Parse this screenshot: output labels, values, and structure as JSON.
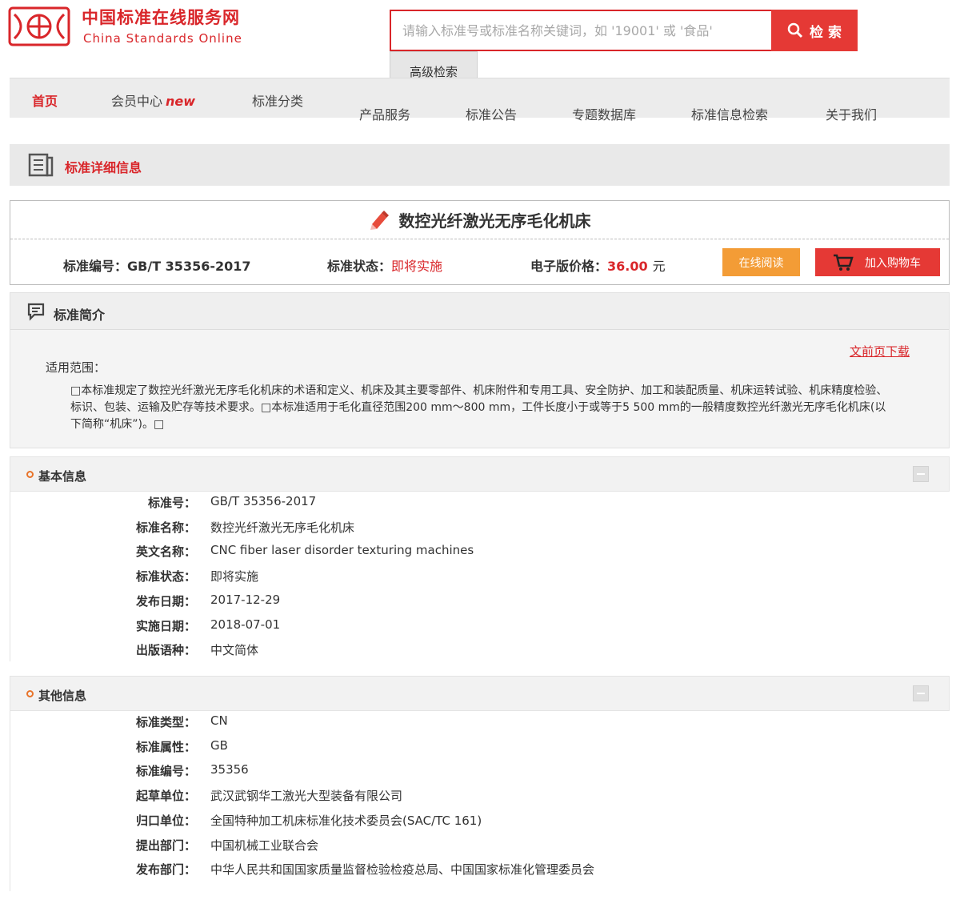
{
  "header": {
    "brand_cn": "中国标准在线服务网",
    "brand_en": "China Standards Online",
    "search_placeholder": "请输入标准号或标准名称关键词，如 '19001' 或 '食品'",
    "search_button": "检 索",
    "advanced_search": "高级检索"
  },
  "nav": {
    "items": [
      "首页",
      "会员中心",
      "标准分类",
      "产品服务",
      "标准公告",
      "专题数据库",
      "标准信息检索",
      "关于我们"
    ],
    "new_badge": "new"
  },
  "detail_bar": {
    "title": "标准详细信息"
  },
  "standard": {
    "title": "数控光纤激光无序毛化机床",
    "code_label": "标准编号：",
    "code": "GB/T 35356-2017",
    "status_label": "标准状态：",
    "status": "即将实施",
    "price_label": "电子版价格：",
    "price": "36.00",
    "price_unit": "元",
    "read_button": "在线阅读",
    "cart_button": "加入购物车"
  },
  "intro": {
    "heading": "标准简介",
    "download": "文前页下载",
    "scope_label": "适用范围：",
    "scope_text": "□本标准规定了数控光纤激光无序毛化机床的术语和定义、机床及其主要零部件、机床附件和专用工具、安全防护、加工和装配质量、机床运转试验、机床精度检验、标识、包装、运输及贮存等技术要求。□本标准适用于毛化直径范围200 mm～800 mm，工件长度小于或等于5 500 mm的一般精度数控光纤激光无序毛化机床(以下简称“机床”)。□"
  },
  "basic_info": {
    "heading": "基本信息",
    "fields": [
      {
        "label": "标准号：",
        "value": "GB/T 35356-2017"
      },
      {
        "label": "标准名称：",
        "value": "数控光纤激光无序毛化机床"
      },
      {
        "label": "英文名称：",
        "value": "CNC fiber laser disorder texturing machines"
      },
      {
        "label": "标准状态：",
        "value": "即将实施"
      },
      {
        "label": "发布日期：",
        "value": "2017-12-29"
      },
      {
        "label": "实施日期：",
        "value": "2018-07-01"
      },
      {
        "label": "出版语种：",
        "value": "中文简体"
      }
    ]
  },
  "other_info": {
    "heading": "其他信息",
    "fields": [
      {
        "label": "标准类型：",
        "value": "CN"
      },
      {
        "label": "标准属性：",
        "value": "GB"
      },
      {
        "label": "标准编号：",
        "value": "35356"
      },
      {
        "label": "起草单位：",
        "value": "武汉武钢华工激光大型装备有限公司"
      },
      {
        "label": "归口单位：",
        "value": "全国特种加工机床标准化技术委员会(SAC/TC 161)"
      },
      {
        "label": "提出部门：",
        "value": "中国机械工业联合会"
      },
      {
        "label": "发布部门：",
        "value": "中华人民共和国国家质量监督检验检疫总局、中国国家标准化管理委员会"
      }
    ]
  },
  "colors": {
    "brand_red": "#d9262a",
    "button_red": "#e53935",
    "button_orange": "#f39c36"
  }
}
